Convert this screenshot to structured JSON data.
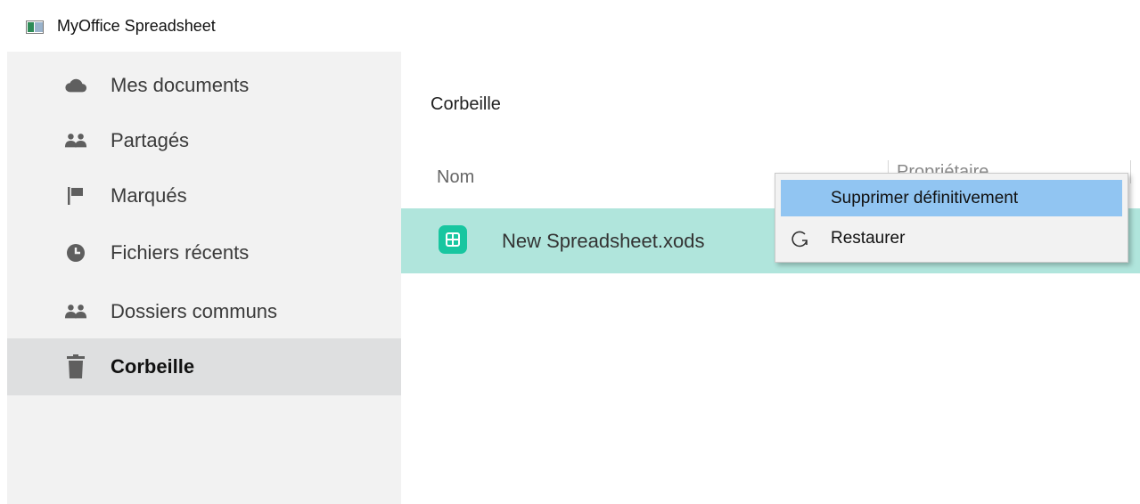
{
  "window": {
    "title": "MyOffice Spreadsheet",
    "icon": "app-window-icon"
  },
  "sidebar": {
    "items": [
      {
        "label": "Mes documents",
        "icon": "cloud-icon",
        "active": false
      },
      {
        "label": "Partagés",
        "icon": "people-icon",
        "active": false
      },
      {
        "label": "Marqués",
        "icon": "flag-icon",
        "active": false
      },
      {
        "label": "Fichiers récents",
        "icon": "clock-icon",
        "active": false
      },
      {
        "label": "Dossiers communs",
        "icon": "people-icon",
        "active": false
      },
      {
        "label": "Corbeille",
        "icon": "trash-icon",
        "active": true
      }
    ]
  },
  "main": {
    "title": "Corbeille",
    "columns": [
      "Nom",
      "Propriétaire"
    ],
    "files": [
      {
        "name": "New Spreadsheet.xods",
        "icon": "spreadsheet-file-icon",
        "selected": true
      }
    ]
  },
  "context_menu": {
    "items": [
      {
        "label": "Supprimer définitivement",
        "icon": "",
        "highlighted": true
      },
      {
        "label": "Restaurer",
        "icon": "restore-icon",
        "highlighted": false
      }
    ]
  },
  "colors": {
    "sidebar_bg": "#f2f2f2",
    "active_item_bg": "#dedfe0",
    "selected_row_bg": "#b0e5dc",
    "file_icon": "#18c6a0",
    "menu_highlight": "#91c5f2",
    "icon_gray": "#5f5f5f"
  }
}
